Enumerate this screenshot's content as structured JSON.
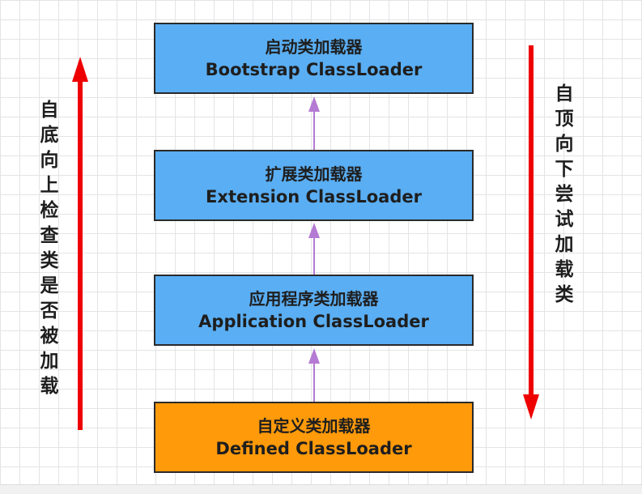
{
  "boxes": [
    {
      "cn": "启动类加载器",
      "en": "Bootstrap ClassLoader"
    },
    {
      "cn": "扩展类加载器",
      "en": "Extension ClassLoader"
    },
    {
      "cn": "应用程序类加载器",
      "en": "Application ClassLoader"
    },
    {
      "cn": "自定义类加载器",
      "en": "Defined ClassLoader"
    }
  ],
  "captions": {
    "left": "自底向上检查类是否被加载",
    "right": "自顶向下尝试加载类"
  },
  "colors": {
    "box_blue": "#5aaef3",
    "box_orange": "#ff9a0a",
    "side_arrow_red": "#ee0000",
    "connector_purple": "#b57ad3"
  }
}
